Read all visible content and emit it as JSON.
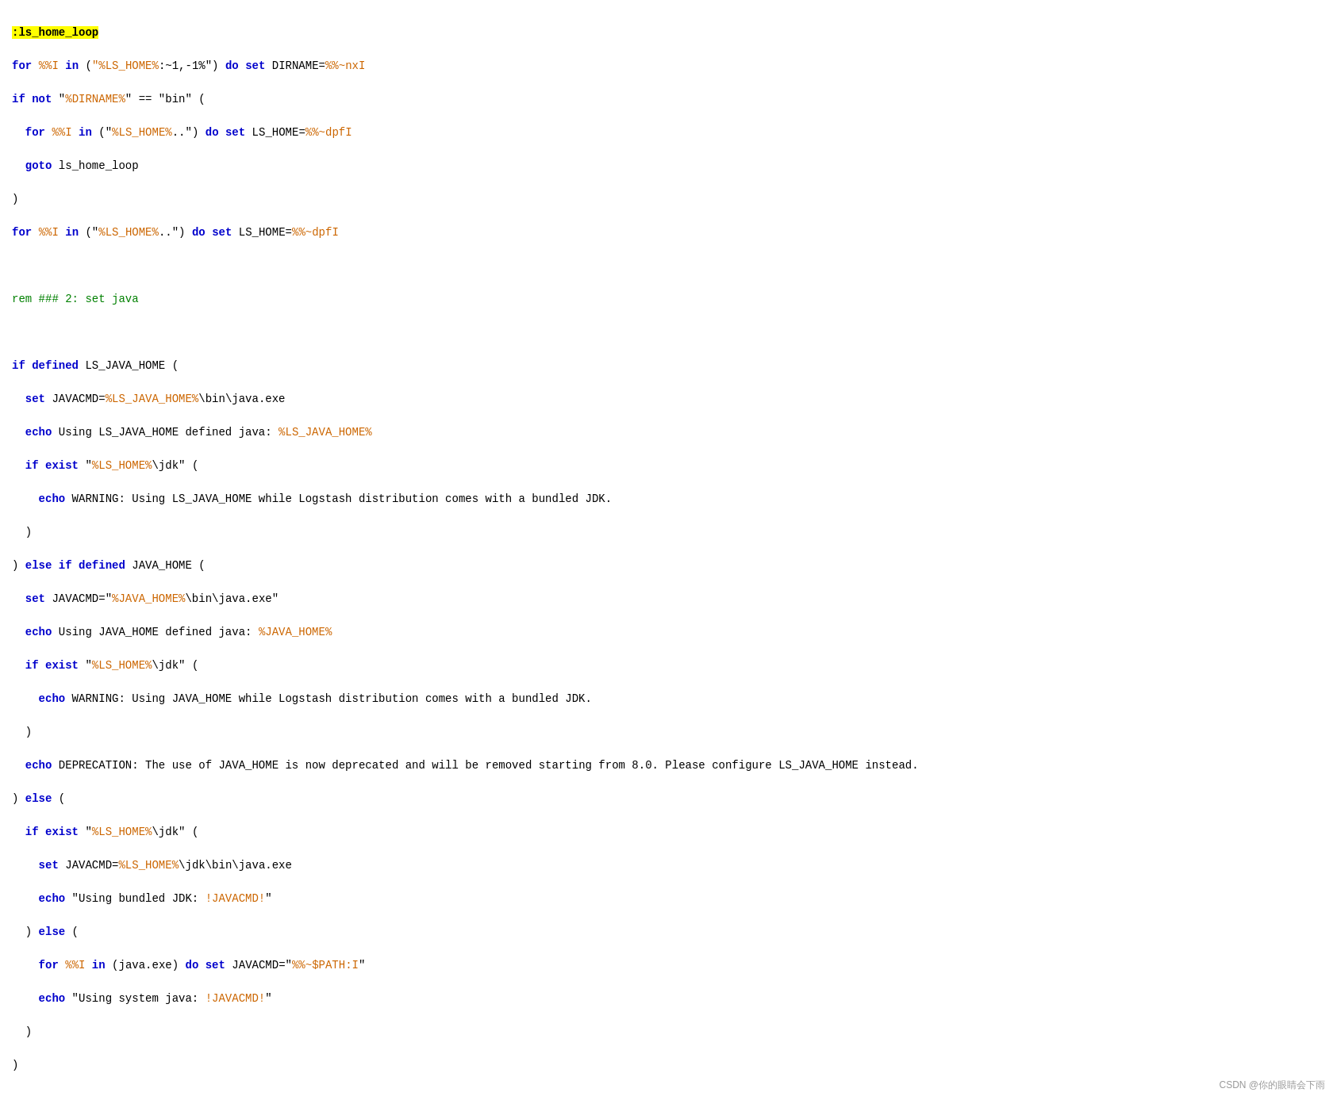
{
  "watermark": "CSDN @你的眼睛会下雨",
  "code": {
    "lines": []
  }
}
